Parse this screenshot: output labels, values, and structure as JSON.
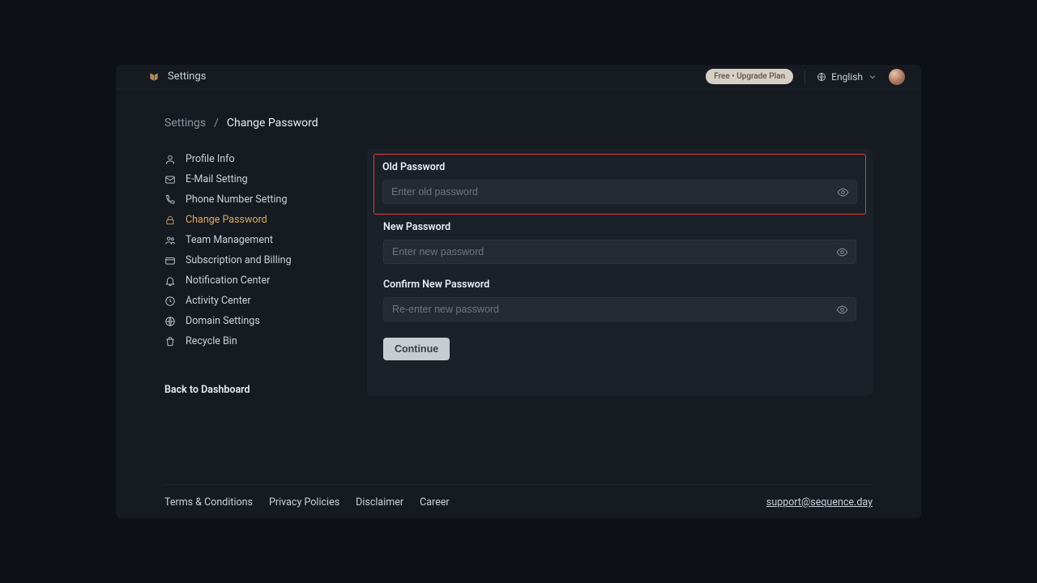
{
  "topbar": {
    "title": "Settings",
    "upgrade_label": "Free • Upgrade Plan",
    "language": "English"
  },
  "breadcrumb": {
    "root": "Settings",
    "sep": "/",
    "current": "Change Password"
  },
  "sidebar": {
    "items": [
      {
        "label": "Profile Info"
      },
      {
        "label": "E-Mail Setting"
      },
      {
        "label": "Phone Number Setting"
      },
      {
        "label": "Change Password"
      },
      {
        "label": "Team Management"
      },
      {
        "label": "Subscription and Billing"
      },
      {
        "label": "Notification Center"
      },
      {
        "label": "Activity Center"
      },
      {
        "label": "Domain Settings"
      },
      {
        "label": "Recycle Bin"
      }
    ],
    "back": "Back to Dashboard"
  },
  "form": {
    "old_label": "Old Password",
    "old_placeholder": "Enter old password",
    "new_label": "New Password",
    "new_placeholder": "Enter new password",
    "confirm_label": "Confirm New Password",
    "confirm_placeholder": "Re-enter new password",
    "continue": "Continue"
  },
  "footer": {
    "links": {
      "terms": "Terms & Conditions",
      "privacy": "Privacy Policies",
      "disclaimer": "Disclaimer",
      "career": "Career"
    },
    "support": "support@sequence.day"
  }
}
